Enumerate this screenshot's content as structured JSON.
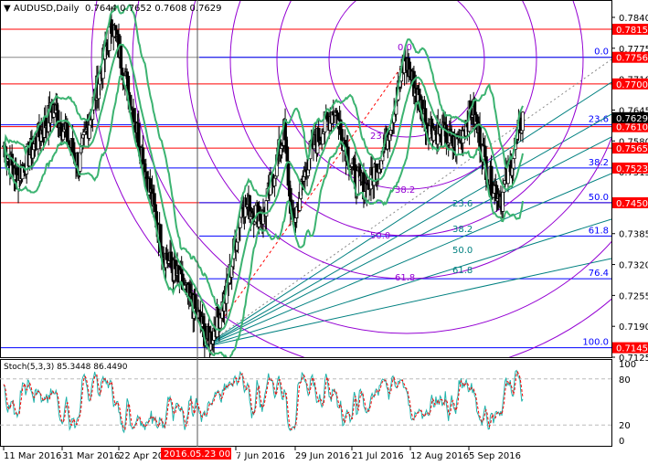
{
  "title": {
    "symbol": "AUDUSD,Daily",
    "open": "0.7644",
    "high": "0.7652",
    "low": "0.7608",
    "close": "0.7629"
  },
  "indicator_label": "Stoch(5,3,3) 85.3448 86.4490",
  "price_axis": [
    "0.7840",
    "0.7775",
    "0.7710",
    "0.7645",
    "0.7580",
    "0.7515",
    "0.7385",
    "0.7320",
    "0.7255",
    "0.7190",
    "0.7125"
  ],
  "red_levels": [
    "0.7815",
    "0.7700",
    "0.7610",
    "0.7565",
    "0.7450"
  ],
  "highlighted_labels": [
    {
      "text": "0.7815",
      "price": 0.7815
    },
    {
      "text": "0.7756",
      "price": 0.7756
    },
    {
      "text": "0.7700",
      "price": 0.77
    },
    {
      "text": "0.7610",
      "price": 0.761
    },
    {
      "text": "0.7565",
      "price": 0.7565
    },
    {
      "text": "0.7523",
      "price": 0.7523
    },
    {
      "text": "0.7450",
      "price": 0.745
    },
    {
      "text": "0.7145",
      "price": 0.7145
    }
  ],
  "current_price": "0.7629",
  "fib_retracement": [
    {
      "label": "0.0",
      "price": 0.7756
    },
    {
      "label": "23.6",
      "price": 0.7614
    },
    {
      "label": "38.2",
      "price": 0.7523
    },
    {
      "label": "50.0",
      "price": 0.745
    },
    {
      "label": "61.8",
      "price": 0.738
    },
    {
      "label": "76.4",
      "price": 0.729
    },
    {
      "label": "100.0",
      "price": 0.7145
    }
  ],
  "fib_arc_labels": [
    "0.0",
    "23.6",
    "38.2",
    "50.0",
    "61.8"
  ],
  "fib_fan_labels": [
    "23.6",
    "38.2",
    "50.0",
    "61.8"
  ],
  "stoch_axis": [
    "100",
    "80",
    "20",
    "0"
  ],
  "time_axis": [
    "11 Mar 2016",
    "31 Mar 2016",
    "22 Apr 2016",
    "7 Jun 2016",
    "29 Jun 2016",
    "21 Jul 2016",
    "12 Aug 2016",
    "5 Sep 2016"
  ],
  "crosshair_date": "2016.05.23 00:00",
  "colors": {
    "bull": "#000000",
    "red": "#ff0000",
    "blue": "#0000ff",
    "green": "#3cb371",
    "purple": "#9400d3",
    "teal": "#008080"
  },
  "chart_data": {
    "type": "candlestick",
    "note": "approximate close path waypoints [candle index, price]",
    "waypoints": [
      [
        0,
        0.757
      ],
      [
        3,
        0.75
      ],
      [
        12,
        0.765
      ],
      [
        18,
        0.753
      ],
      [
        26,
        0.783
      ],
      [
        32,
        0.76
      ],
      [
        38,
        0.735
      ],
      [
        46,
        0.722
      ],
      [
        49,
        0.7155
      ],
      [
        53,
        0.725
      ],
      [
        57,
        0.745
      ],
      [
        62,
        0.742
      ],
      [
        67,
        0.76
      ],
      [
        69,
        0.74
      ],
      [
        73,
        0.755
      ],
      [
        79,
        0.765
      ],
      [
        84,
        0.75
      ],
      [
        87,
        0.748
      ],
      [
        91,
        0.757
      ],
      [
        96,
        0.775
      ],
      [
        101,
        0.762
      ],
      [
        108,
        0.757
      ],
      [
        112,
        0.765
      ],
      [
        116,
        0.75
      ],
      [
        119,
        0.746
      ],
      [
        124,
        0.763
      ]
    ]
  }
}
